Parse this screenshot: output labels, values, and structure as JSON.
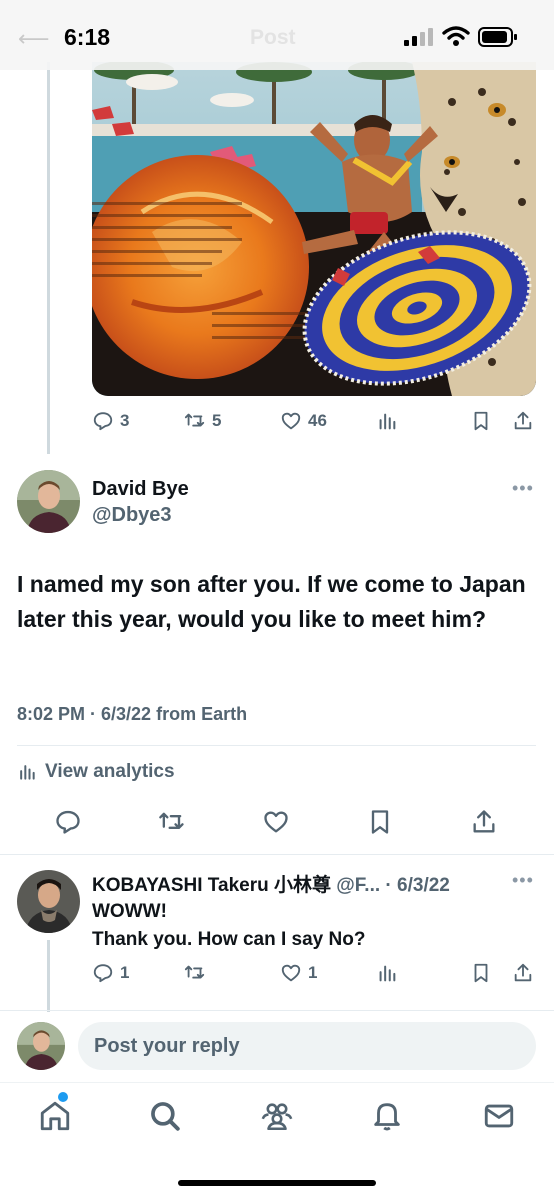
{
  "status_bar": {
    "time": "6:18",
    "faded_title": "Post"
  },
  "original_post": {
    "actions": {
      "replies": "3",
      "reposts": "5",
      "likes": "46"
    }
  },
  "focused_post": {
    "author_name": "David Bye",
    "author_handle": "@Dbye3",
    "text": "I named my son after you.  If we come to Japan later this year, would you like to meet him?",
    "timestamp": "8:02 PM · 6/3/22 from Earth",
    "view_analytics_label": "View analytics"
  },
  "reply": {
    "author_name": "KOBAYASHI Takeru 小林尊",
    "author_handle_truncated": "@F...",
    "date": "· 6/3/22",
    "line1": "WOWW!",
    "line2": "Thank you. How can I say No?",
    "actions": {
      "replies": "1",
      "likes": "1"
    }
  },
  "composer": {
    "placeholder": "Post your reply"
  },
  "tabbar": {
    "items": [
      "home-icon",
      "search-icon",
      "communities-icon",
      "notifications-icon",
      "messages-icon"
    ]
  },
  "colors": {
    "accent": "#1d9bf0",
    "secondary_text": "#536471",
    "primary_text": "#0f1419"
  }
}
